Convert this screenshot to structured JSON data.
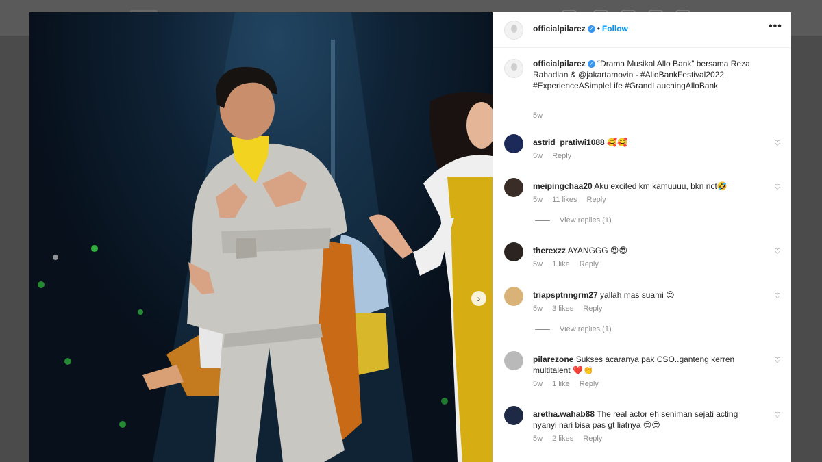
{
  "post": {
    "username": "officialpilarez",
    "follow_label": "Follow",
    "dot": "•",
    "more_label": "•••",
    "verified_glyph": "✓",
    "caption": "“Drama Musikal Allo Bank” bersama Reza Rahadian & @jakartamovin - #AlloBankFestival2022 #ExperienceASimpleLife #GrandLauchingAlloBank",
    "caption_time": "5w",
    "next_icon": "chevron-right-icon"
  },
  "comments": [
    {
      "username": "astrid_pratiwi1088",
      "text": "🥰🥰",
      "time": "5w",
      "likes": "",
      "reply": "Reply",
      "view_replies": "",
      "avatar_color": "#1c2a5a"
    },
    {
      "username": "meipingchaa20",
      "text": "Aku excited km kamuuuu, bkn nct🤣",
      "time": "5w",
      "likes": "11 likes",
      "reply": "Reply",
      "view_replies": "View replies (1)",
      "avatar_color": "#3a2d28"
    },
    {
      "username": "therexzz",
      "text": "AYANGGG 😍😍",
      "time": "5w",
      "likes": "1 like",
      "reply": "Reply",
      "view_replies": "",
      "avatar_color": "#2b2420"
    },
    {
      "username": "triapsptnngrm27",
      "text": "yallah mas suami 😍",
      "time": "5w",
      "likes": "3 likes",
      "reply": "Reply",
      "view_replies": "View replies (1)",
      "avatar_color": "#d9b277"
    },
    {
      "username": "pilarezone",
      "text": "Sukses acaranya pak CSO..ganteng kerren multitalent ❤️👏",
      "time": "5w",
      "likes": "1 like",
      "reply": "Reply",
      "view_replies": "",
      "avatar_color": "#b9b9b9"
    },
    {
      "username": "aretha.wahab88",
      "text": "The real actor eh seniman sejati acting nyanyi nari bisa pas gt liatnya 😍😍",
      "time": "5w",
      "likes": "2 likes",
      "reply": "Reply",
      "view_replies": "",
      "avatar_color": "#1e2a45"
    }
  ],
  "heart_glyph": "♡"
}
